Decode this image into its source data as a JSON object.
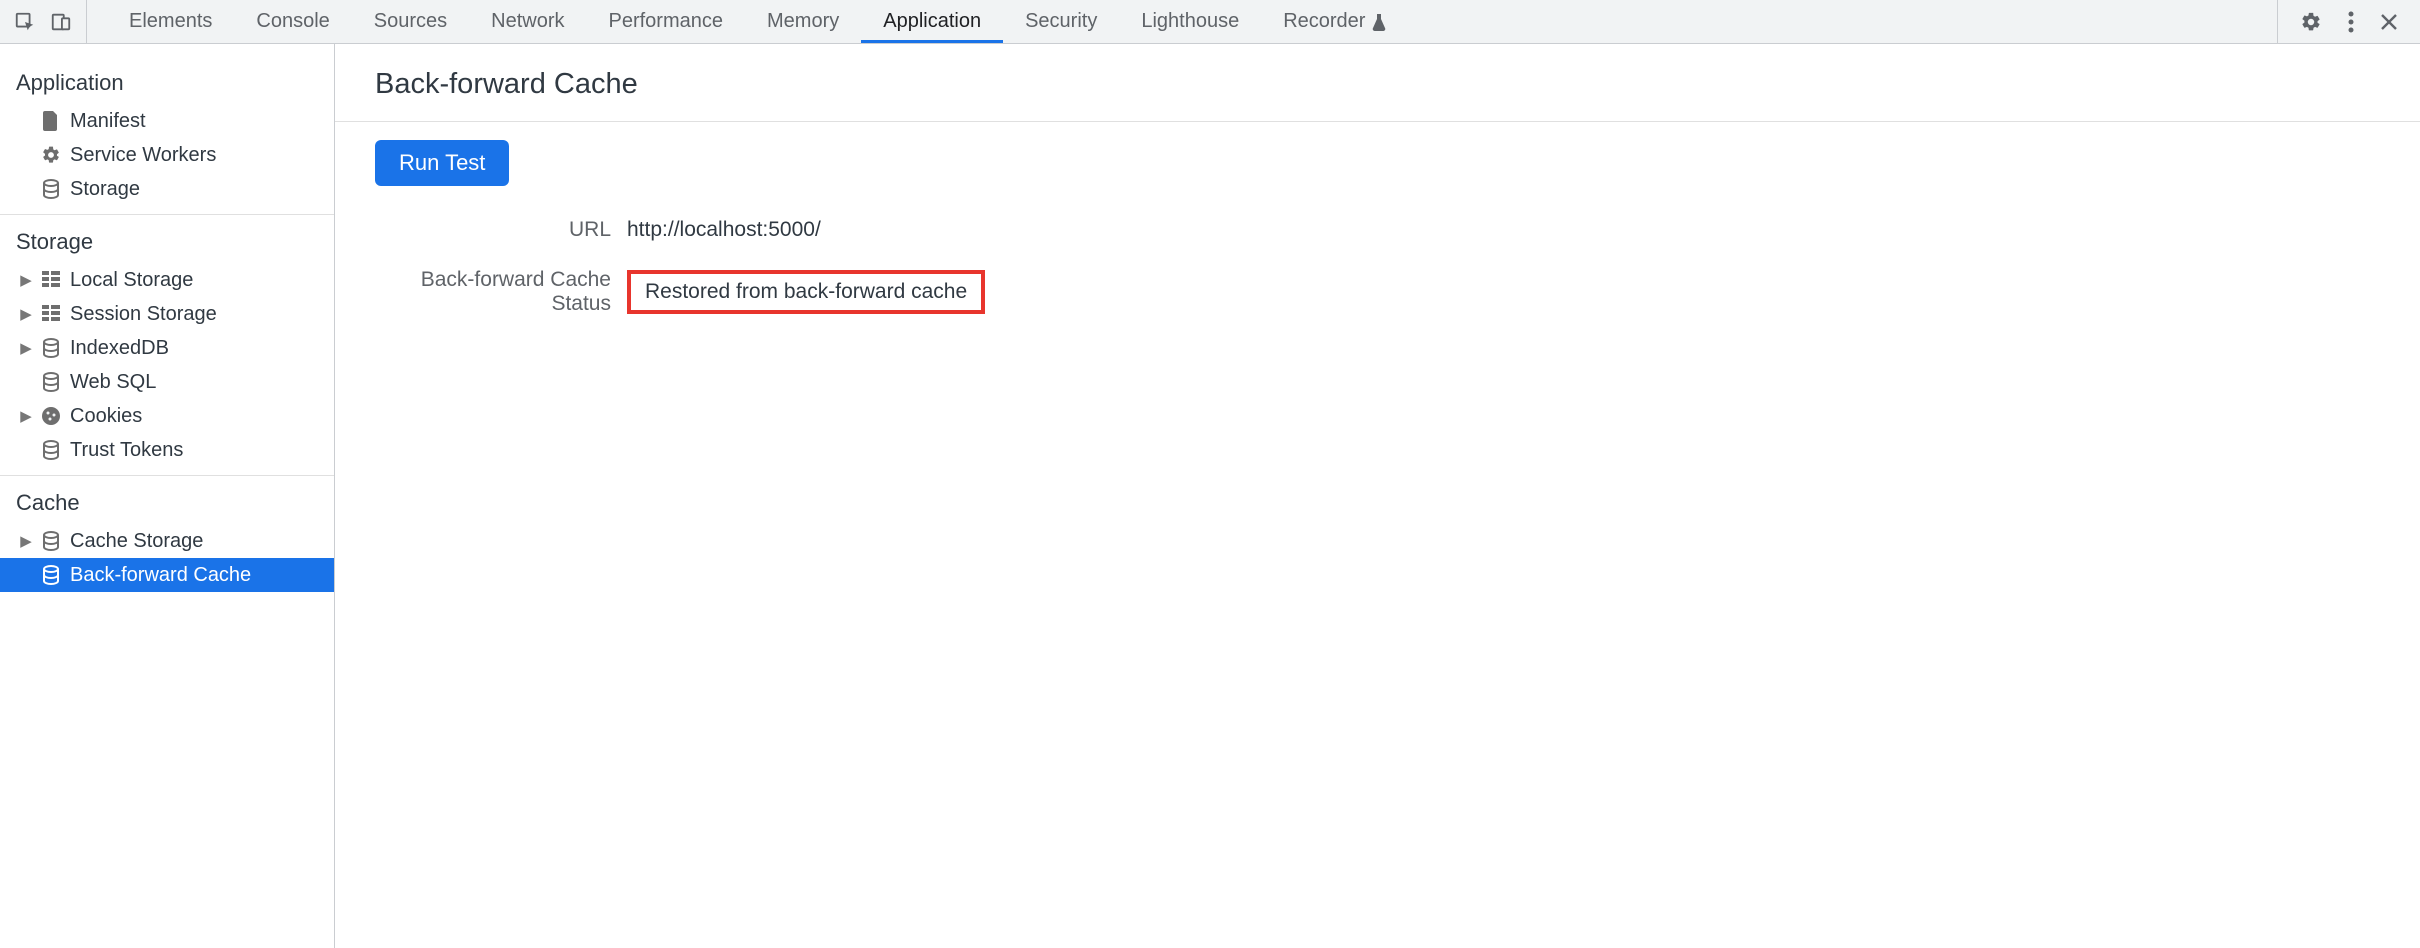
{
  "topbar": {
    "tabs": [
      {
        "label": "Elements",
        "active": false
      },
      {
        "label": "Console",
        "active": false
      },
      {
        "label": "Sources",
        "active": false
      },
      {
        "label": "Network",
        "active": false
      },
      {
        "label": "Performance",
        "active": false
      },
      {
        "label": "Memory",
        "active": false
      },
      {
        "label": "Application",
        "active": true
      },
      {
        "label": "Security",
        "active": false
      },
      {
        "label": "Lighthouse",
        "active": false
      },
      {
        "label": "Recorder",
        "active": false,
        "experimental": true
      }
    ]
  },
  "sidebar": {
    "sections": [
      {
        "title": "Application",
        "items": [
          {
            "label": "Manifest",
            "icon": "file",
            "expandable": false,
            "selected": false
          },
          {
            "label": "Service Workers",
            "icon": "gear",
            "expandable": false,
            "selected": false
          },
          {
            "label": "Storage",
            "icon": "db",
            "expandable": false,
            "selected": false
          }
        ]
      },
      {
        "title": "Storage",
        "items": [
          {
            "label": "Local Storage",
            "icon": "grid",
            "expandable": true,
            "selected": false
          },
          {
            "label": "Session Storage",
            "icon": "grid",
            "expandable": true,
            "selected": false
          },
          {
            "label": "IndexedDB",
            "icon": "db",
            "expandable": true,
            "selected": false
          },
          {
            "label": "Web SQL",
            "icon": "db",
            "expandable": false,
            "selected": false
          },
          {
            "label": "Cookies",
            "icon": "cookie",
            "expandable": true,
            "selected": false
          },
          {
            "label": "Trust Tokens",
            "icon": "db",
            "expandable": false,
            "selected": false
          }
        ]
      },
      {
        "title": "Cache",
        "items": [
          {
            "label": "Cache Storage",
            "icon": "db",
            "expandable": true,
            "selected": false
          },
          {
            "label": "Back-forward Cache",
            "icon": "db",
            "expandable": false,
            "selected": true
          }
        ]
      }
    ]
  },
  "content": {
    "title": "Back-forward Cache",
    "run_button": "Run Test",
    "rows": [
      {
        "label": "URL",
        "value": "http://localhost:5000/",
        "highlight": false
      },
      {
        "label": "Back-forward Cache Status",
        "value": "Restored from back-forward cache",
        "highlight": true
      }
    ]
  }
}
